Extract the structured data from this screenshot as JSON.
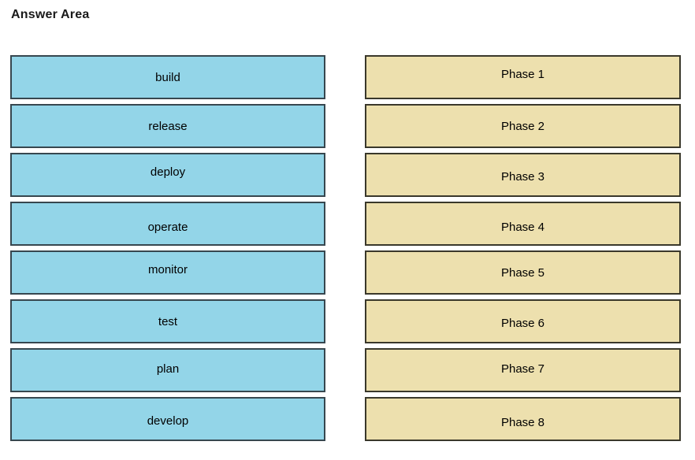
{
  "page": {
    "title": "Answer Area",
    "background_color": "#ffffff"
  },
  "colors": {
    "source_box_fill": "#93d5e8",
    "source_box_border": "#37474f",
    "target_box_fill": "#ede0ae",
    "target_box_border": "#3a382b",
    "text_color": "#000000"
  },
  "left_column": {
    "name": "drag-source-list",
    "items": [
      {
        "label": "build",
        "align": "center"
      },
      {
        "label": "release",
        "align": "center"
      },
      {
        "label": "deploy",
        "align": "up"
      },
      {
        "label": "operate",
        "align": "down"
      },
      {
        "label": "monitor",
        "align": "up"
      },
      {
        "label": "test",
        "align": "center"
      },
      {
        "label": "plan",
        "align": "up2"
      },
      {
        "label": "develop",
        "align": "down2"
      }
    ]
  },
  "right_column": {
    "name": "drop-target-list",
    "items": [
      {
        "label": "Phase 1",
        "align": "up"
      },
      {
        "label": "Phase 2",
        "align": "center"
      },
      {
        "label": "Phase 3",
        "align": "down2"
      },
      {
        "label": "Phase 4",
        "align": "down"
      },
      {
        "label": "Phase 5",
        "align": "center"
      },
      {
        "label": "Phase 6",
        "align": "down2"
      },
      {
        "label": "Phase 7",
        "align": "up2"
      },
      {
        "label": "Phase 8",
        "align": "down"
      }
    ]
  }
}
